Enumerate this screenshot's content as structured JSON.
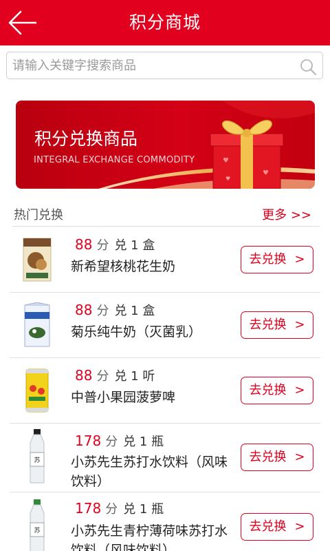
{
  "header": {
    "title": "积分商城",
    "back_icon": "back-arrow-icon"
  },
  "search": {
    "placeholder": "请输入关键字搜索商品",
    "value": "",
    "icon": "search-icon"
  },
  "banner": {
    "title": "积分兑换商品",
    "subtitle": "INTEGRAL EXCHANGE COMMODITY",
    "image": "gift-box"
  },
  "section": {
    "title": "热门兑换",
    "more": "更多 >>"
  },
  "colors": {
    "primary": "#e1001d",
    "text": "#222222",
    "muted": "#666666"
  },
  "items": [
    {
      "points": "88",
      "unit": "分",
      "qty": "兑 1 盒",
      "name": "新希望核桃花生奶",
      "button": "去兑换",
      "arrow": ">",
      "image": "nut-milk-carton"
    },
    {
      "points": "88",
      "unit": "分",
      "qty": "兑 1 盒",
      "name": "菊乐纯牛奶（灭菌乳）",
      "button": "去兑换",
      "arrow": ">",
      "image": "milk-carton"
    },
    {
      "points": "88",
      "unit": "分",
      "qty": "兑 1 听",
      "name": "中普小果园菠萝啤",
      "button": "去兑换",
      "arrow": ">",
      "image": "pineapple-beer-can"
    },
    {
      "points": "178",
      "unit": "分",
      "qty": "兑 1 瓶",
      "name": "小苏先生苏打水饮料（风味饮料）",
      "button": "去兑换",
      "arrow": ">",
      "image": "soda-water-bottle"
    },
    {
      "points": "178",
      "unit": "分",
      "qty": "兑 1 瓶",
      "name": "小苏先生青柠薄荷味苏打水饮料（风味饮料）",
      "button": "去兑换",
      "arrow": ">",
      "image": "lime-soda-bottle"
    }
  ]
}
